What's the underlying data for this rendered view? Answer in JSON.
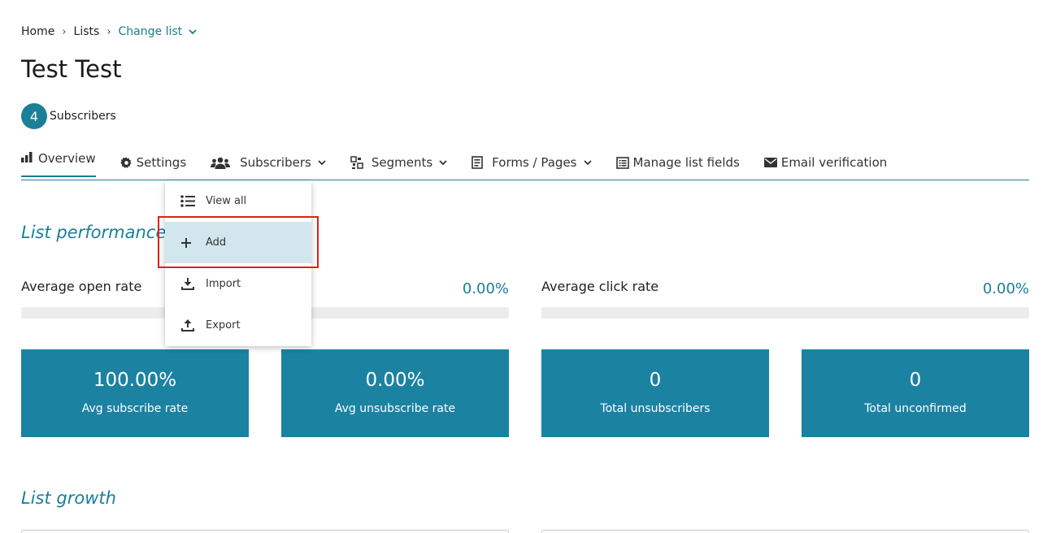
{
  "breadcrumb": {
    "home": "Home",
    "lists": "Lists",
    "separator": "›",
    "change_list": "Change list"
  },
  "page": {
    "title": "Test Test"
  },
  "subscribers_badge": {
    "count": "4",
    "label": "Subscribers"
  },
  "tabs": {
    "overview": "Overview",
    "settings": "Settings",
    "subscribers": "Subscribers",
    "segments": "Segments",
    "forms_pages": "Forms / Pages",
    "manage_fields": "Manage list fields",
    "email_verification": "Email verification"
  },
  "dropdown": {
    "view_all": "View all",
    "add": "Add",
    "import": "Import",
    "export": "Export"
  },
  "performance": {
    "title": "List performance",
    "open_rate_label": "Average open rate",
    "open_rate_value": "0.00%",
    "open_rate_fraction": 0,
    "click_rate_label": "Average click rate",
    "click_rate_value": "0.00%",
    "click_rate_fraction": 0
  },
  "stats": [
    {
      "value": "100.00%",
      "label": "Avg subscribe rate"
    },
    {
      "value": "0.00%",
      "label": "Avg unsubscribe rate"
    },
    {
      "value": "0",
      "label": "Total unsubscribers"
    },
    {
      "value": "0",
      "label": "Total unconfirmed"
    }
  ],
  "growth": {
    "title": "List growth"
  },
  "colors": {
    "accent": "#1b7f98",
    "stat_card": "#1b82a2",
    "dropdown_hover": "#d2e6ed",
    "highlight_border": "#e0201a"
  }
}
